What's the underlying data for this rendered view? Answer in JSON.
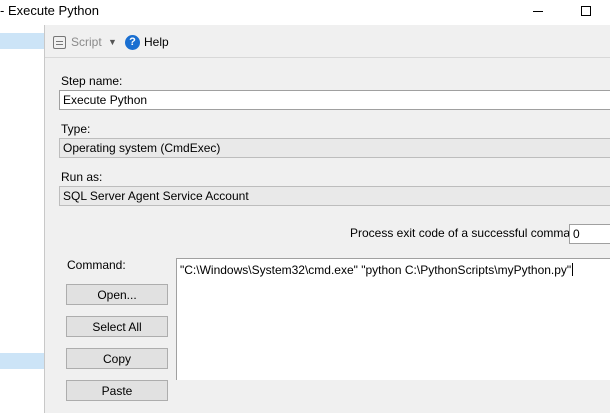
{
  "window": {
    "title": "- Execute Python"
  },
  "toolbar": {
    "script_label": "Script",
    "help_label": "Help"
  },
  "form": {
    "step_name_label": "Step name:",
    "step_name_value": "Execute Python",
    "type_label": "Type:",
    "type_value": "Operating system (CmdExec)",
    "run_as_label": "Run as:",
    "run_as_value": "SQL Server Agent Service Account",
    "exit_code_label": "Process exit code of a successful command:",
    "exit_code_value": "0",
    "command_label": "Command:",
    "command_value": "\"C:\\Windows\\System32\\cmd.exe\" \"python C:\\PythonScripts\\myPython.py\""
  },
  "buttons": {
    "open": "Open...",
    "select_all": "Select All",
    "copy": "Copy",
    "paste": "Paste"
  },
  "icons": {
    "script": "script-icon",
    "dropdown": "chevron-down-icon",
    "help": "help-icon",
    "minimize": "minimize-icon",
    "maximize": "maximize-icon"
  },
  "colors": {
    "panel_bg": "#f0f0f0",
    "selection": "#cce4f7",
    "help_blue": "#1a6fd1"
  }
}
